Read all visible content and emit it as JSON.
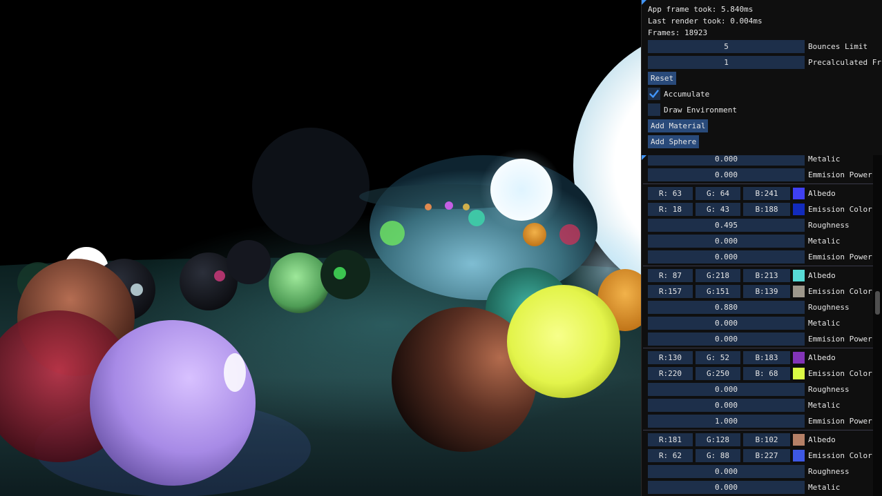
{
  "stats": {
    "frame_time": "App frame took: 5.840ms",
    "render_time": "Last render took: 0.004ms",
    "frames": "Frames: 18923"
  },
  "settings": {
    "bounces_value": "5",
    "bounces_label": "Bounces Limit",
    "precalc_value": "1",
    "precalc_label": "Precalculated Fr",
    "reset_label": "Reset",
    "accumulate_label": "Accumulate",
    "accumulate_checked": true,
    "draw_env_label": "Draw Environment",
    "draw_env_checked": false,
    "add_material_label": "Add Material",
    "add_sphere_label": "Add Sphere"
  },
  "materials": {
    "partial_top": {
      "metalic_value": "0.000",
      "metalic_label": "Metalic",
      "emission_power_value": "0.000",
      "emission_power_label": "Emmision Power"
    },
    "items": [
      {
        "albedo": {
          "r": "R: 63",
          "g": "G: 64",
          "b": "B:241",
          "label": "Albedo",
          "color": "#3f40f1"
        },
        "emission": {
          "r": "R: 18",
          "g": "G: 43",
          "b": "B:188",
          "label": "Emission Color",
          "color": "#122bbc"
        },
        "roughness": {
          "value": "0.495",
          "label": "Roughness"
        },
        "metalic": {
          "value": "0.000",
          "label": "Metalic"
        },
        "emission_power": {
          "value": "0.000",
          "label": "Emmision Power"
        }
      },
      {
        "albedo": {
          "r": "R: 87",
          "g": "G:218",
          "b": "B:213",
          "label": "Albedo",
          "color": "#57dad5"
        },
        "emission": {
          "r": "R:157",
          "g": "G:151",
          "b": "B:139",
          "label": "Emission Color",
          "color": "#9d978b"
        },
        "roughness": {
          "value": "0.880",
          "label": "Roughness"
        },
        "metalic": {
          "value": "0.000",
          "label": "Metalic"
        },
        "emission_power": {
          "value": "0.000",
          "label": "Emmision Power"
        }
      },
      {
        "albedo": {
          "r": "R:130",
          "g": "G: 52",
          "b": "B:183",
          "label": "Albedo",
          "color": "#8234b7"
        },
        "emission": {
          "r": "R:220",
          "g": "G:250",
          "b": "B: 68",
          "label": "Emission Color",
          "color": "#dcfa44"
        },
        "roughness": {
          "value": "0.000",
          "label": "Roughness"
        },
        "metalic": {
          "value": "0.000",
          "label": "Metalic"
        },
        "emission_power": {
          "value": "1.000",
          "label": "Emmision Power"
        }
      },
      {
        "albedo": {
          "r": "R:181",
          "g": "G:128",
          "b": "B:102",
          "label": "Albedo",
          "color": "#b58066"
        },
        "emission": {
          "r": "R: 62",
          "g": "G: 88",
          "b": "B:227",
          "label": "Emission Color",
          "color": "#3e58e3"
        },
        "roughness": {
          "value": "0.000",
          "label": "Roughness"
        },
        "metalic": {
          "value": "0.000",
          "label": "Metalic"
        }
      }
    ]
  },
  "colors": {
    "panel_bg": "#0f0f0f",
    "field_bg": "#1d2f4a",
    "button_bg": "#294a7a",
    "accent": "#4296fa"
  }
}
